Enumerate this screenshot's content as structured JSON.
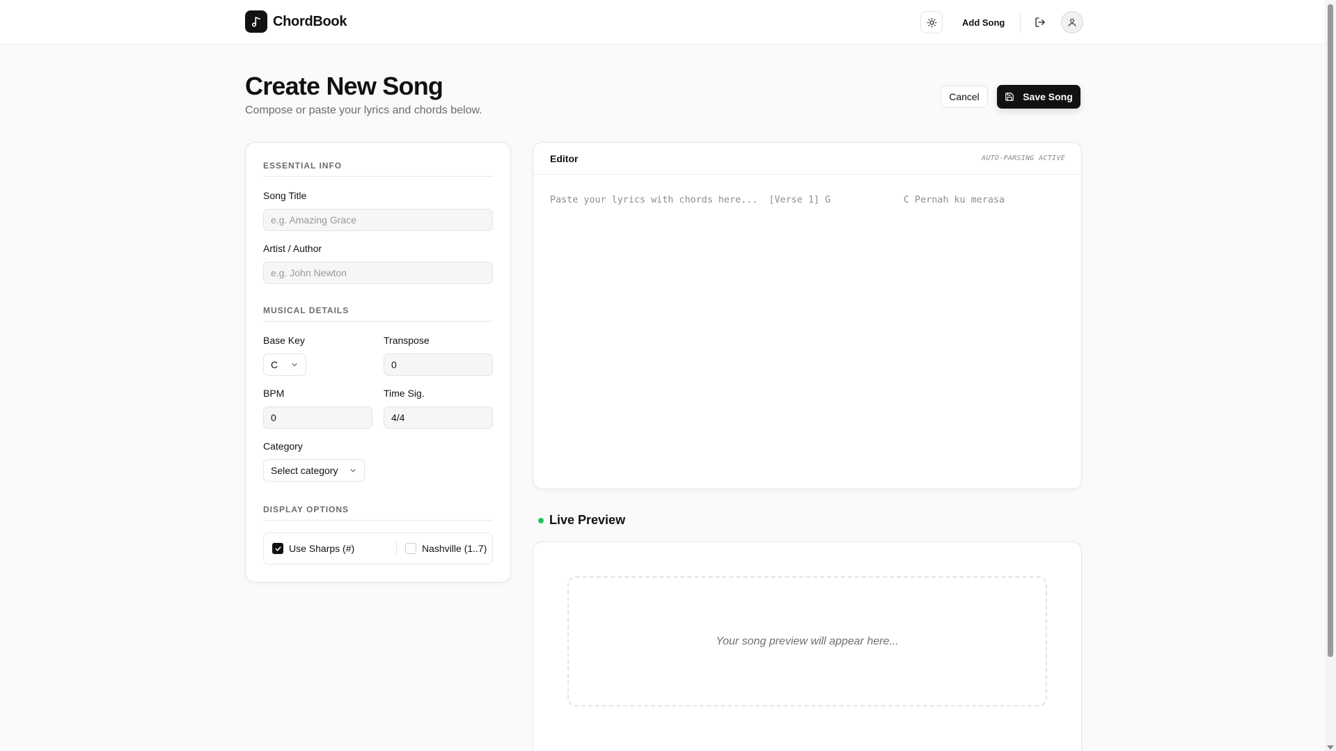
{
  "app": {
    "name": "ChordBook",
    "icons": {
      "logo": "music-note-icon",
      "theme": "sun-icon",
      "logout": "logout-icon",
      "account": "user-icon"
    }
  },
  "header": {
    "add_song_label": "Add Song"
  },
  "page": {
    "title": "Create New Song",
    "subtitle": "Compose or paste your lyrics and chords below.",
    "cancel_label": "Cancel",
    "save_label": "Save Song"
  },
  "form": {
    "essential_heading": "ESSENTIAL INFO",
    "title_label": "Song Title",
    "title_placeholder": "e.g. Amazing Grace",
    "title_value": "",
    "artist_label": "Artist / Author",
    "artist_placeholder": "e.g. John Newton",
    "artist_value": "",
    "musical_heading": "MUSICAL DETAILS",
    "base_key_label": "Base Key",
    "base_key_value": "C",
    "transpose_label": "Transpose",
    "transpose_value": "0",
    "bpm_label": "BPM",
    "bpm_value": "0",
    "time_sig_label": "Time Sig.",
    "time_sig_value": "4/4",
    "category_label": "Category",
    "category_value": "Select category",
    "display_heading": "DISPLAY OPTIONS",
    "use_sharps_label": "Use Sharps (#)",
    "use_sharps_checked": true,
    "nashville_label": "Nashville (1..7)",
    "nashville_checked": false
  },
  "editor": {
    "title": "Editor",
    "status": "AUTO-PARSING ACTIVE",
    "placeholder": "Paste your lyrics with chords here...  [Verse 1] G             C Pernah ku merasa",
    "value": ""
  },
  "preview": {
    "title": "Live Preview",
    "empty_text": "Your song preview will appear here...",
    "status_color": "#22c55e"
  },
  "colors": {
    "primary": "#111111",
    "accent_live": "#22c55e",
    "muted_text": "#6b6b6b"
  }
}
